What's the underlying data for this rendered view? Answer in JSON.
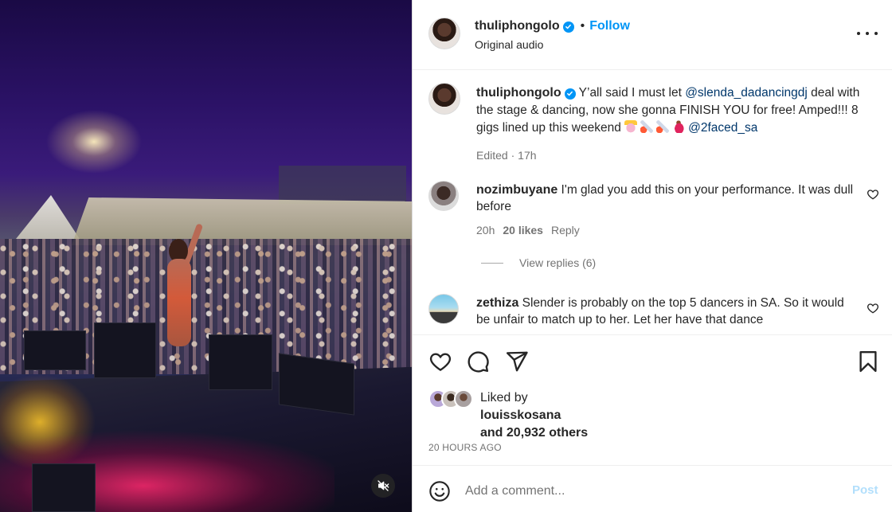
{
  "post": {
    "author": "thuliphongolo",
    "follow_label": "Follow",
    "dot": "•",
    "audio": "Original audio",
    "more_icon": "more-horizontal-icon",
    "verified_icon": "verified-badge-icon"
  },
  "caption": {
    "author": "thuliphongolo",
    "text_1": "Y’all said I must let ",
    "mention_1": "@slenda_dadancingdj",
    "text_2": " deal with the stage & dancing, now she gonna FINISH YOU for free! Amped!!! 8 gigs lined up this weekend ",
    "emojis": [
      "crowned-face-emoji",
      "rocket-emoji",
      "rocket-emoji",
      "woman-dancing-emoji"
    ],
    "mention_2": "@2faced_sa",
    "edited": "Edited",
    "dot": "·",
    "time": "17h"
  },
  "comments": [
    {
      "user": "nozimbuyane",
      "text": "I'm glad you add this on your performance. It was dull before",
      "time": "20h",
      "likes": "20 likes",
      "reply_label": "Reply",
      "view_replies": "View replies (6)"
    },
    {
      "user": "zethiza",
      "text": "Slender is probably on the top 5 dancers in SA. So it would be unfair to match up to her. Let her have that dance"
    }
  ],
  "actions": {
    "like_icon": "heart-icon",
    "comment_icon": "comment-bubble-icon",
    "share_icon": "paper-plane-icon",
    "save_icon": "bookmark-icon"
  },
  "likes": {
    "prefix": "Liked by",
    "user": "louisskosana",
    "others": "and 20,932 others"
  },
  "timestamp": "20 HOURS AGO",
  "add_comment": {
    "placeholder": "Add a comment...",
    "post_label": "Post",
    "emoji_icon": "smiley-icon"
  },
  "media": {
    "mute_icon": "muted-speaker-icon"
  },
  "colors": {
    "link_blue": "#0095f6",
    "mention_blue": "#00376b",
    "muted_text": "#737373",
    "post_disabled": "#b2dffc"
  }
}
